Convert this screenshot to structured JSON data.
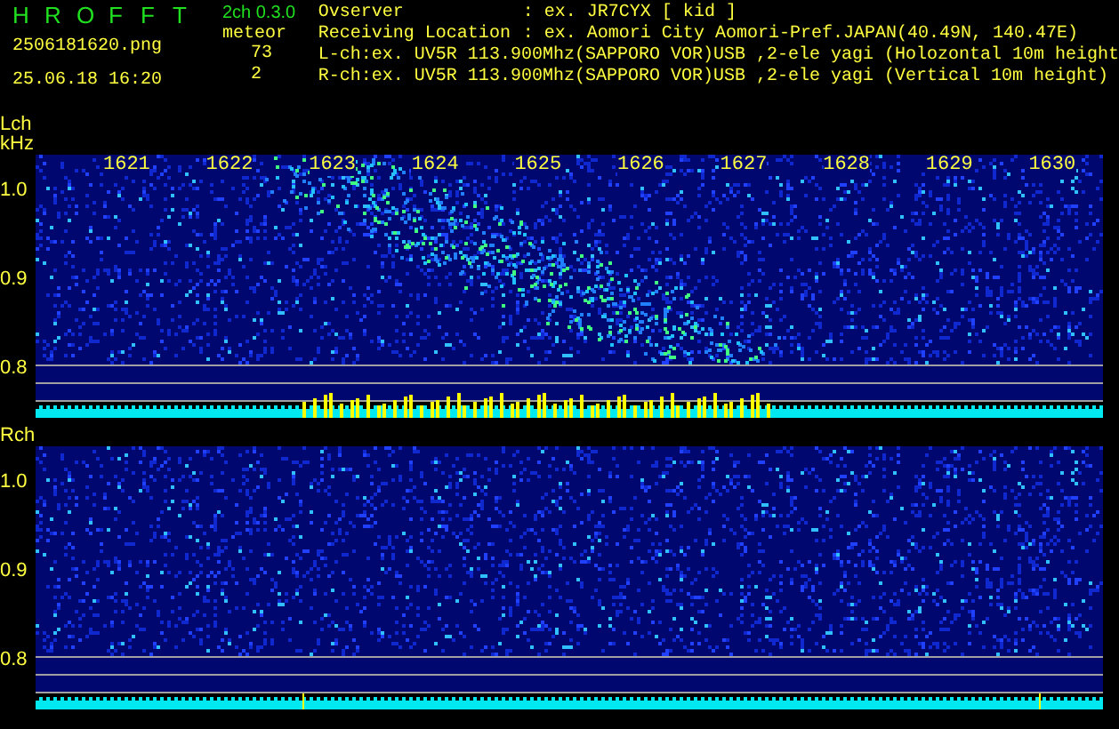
{
  "header": {
    "logo_letters": [
      "H",
      "R",
      "O",
      "F",
      "F",
      "T"
    ],
    "version": "2ch 0.3.0",
    "filename": "2506181620.png",
    "datetime": "25.06.18 16:20",
    "meteor_label": "meteor",
    "counts": [
      "73",
      "2"
    ],
    "info": [
      {
        "label": "Ovserver",
        "value": ": ex. JR7CYX [ kid ]"
      },
      {
        "label": "Receiving Location",
        "value": ": ex. Aomori City Aomori-Pref.JAPAN(40.49N, 140.47E)"
      },
      {
        "label": "L-ch:ex. UV5R 113.900Mhz(SAPPORO VOR)USB ,2-ele yagi (Holozontal 10m height"
      },
      {
        "label": "R-ch:ex. UV5R 113.900Mhz(SAPPORO VOR)USB ,2-ele yagi (Vertical 10m height)"
      }
    ]
  },
  "panels": [
    {
      "label": "Lch",
      "unit": "kHz",
      "freq_labels": [
        "1621",
        "1622",
        "1623",
        "1624",
        "1625",
        "1626",
        "1627",
        "1628",
        "1629",
        "1630"
      ],
      "y_labels": [
        "1.0",
        "0.9",
        "0.8"
      ],
      "echo_visible": true
    },
    {
      "label": "Rch",
      "y_labels": [
        "1.0",
        "0.9",
        "0.8"
      ],
      "echo_visible": false
    }
  ]
}
